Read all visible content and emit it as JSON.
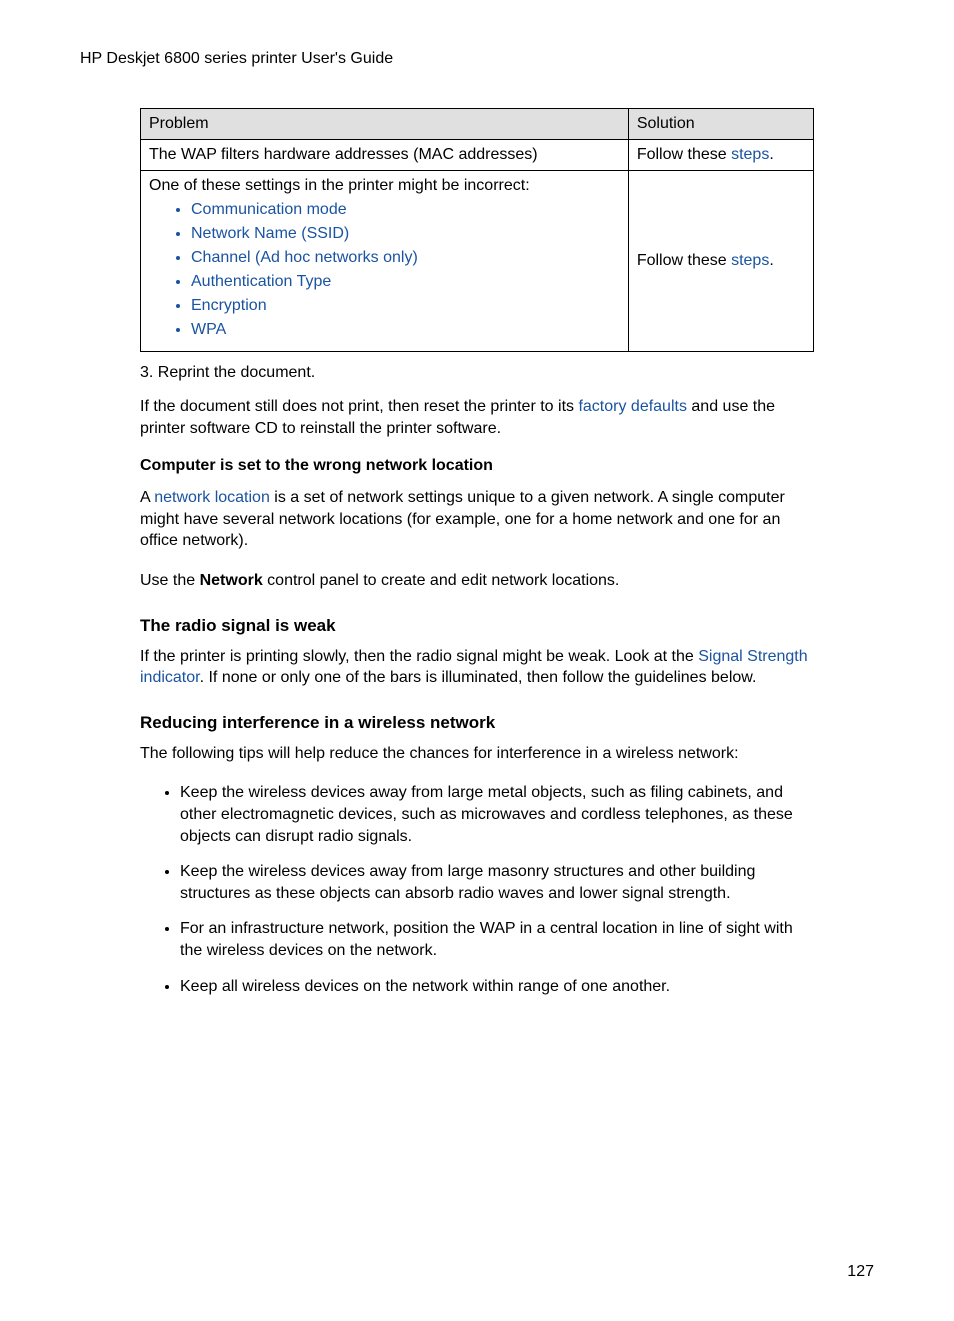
{
  "header": "HP Deskjet 6800 series printer User's Guide",
  "table": {
    "head_problem": "Problem",
    "head_solution": "Solution",
    "row1_problem": "The WAP filters hardware addresses (MAC addresses)",
    "row1_solution_prefix": "Follow these ",
    "row1_solution_link": "steps",
    "row2_problem_intro": "One of these settings in the printer might be incorrect:",
    "row2_items": {
      "a": "Communication mode",
      "b": "Network Name (SSID)",
      "c": "Channel (Ad hoc networks only)",
      "d": "Authentication Type",
      "e": "Encryption",
      "f": "WPA"
    },
    "row2_solution_prefix": "Follow these ",
    "row2_solution_link": "steps"
  },
  "step3": "3.  Reprint the document.",
  "para1_a": "If the document still does not print, then reset the printer to its ",
  "para1_link": "factory defaults",
  "para1_b": " and use the printer software CD to reinstall the printer software.",
  "sub1": "Computer is set to the wrong network location",
  "para2_a": "A ",
  "para2_link": "network location",
  "para2_b": " is a set of network settings unique to a given network. A single computer might have several network locations (for example, one for a home network and one for an office network).",
  "para3_a": "Use the ",
  "para3_bold": "Network",
  "para3_b": " control panel to create and edit network locations.",
  "h2_1": "The radio signal is weak",
  "para4_a": "If the printer is printing slowly, then the radio signal might be weak. Look at the ",
  "para4_link": "Signal Strength indicator",
  "para4_b": ". If none or only one of the bars is illuminated, then follow the guidelines below.",
  "h2_2": "Reducing interference in a wireless network",
  "para5": "The following tips will help reduce the chances for interference in a wireless network:",
  "tips": {
    "a": "Keep the wireless devices away from large metal objects, such as filing cabinets, and other electromagnetic devices, such as microwaves and cordless telephones, as these objects can disrupt radio signals.",
    "b": "Keep the wireless devices away from large masonry structures and other building structures as these objects can absorb radio waves and lower signal strength.",
    "c": "For an infrastructure network, position the WAP in a central location in line of sight with the wireless devices on the network.",
    "d": "Keep all wireless devices on the network within range of one another."
  },
  "page_num": "127"
}
